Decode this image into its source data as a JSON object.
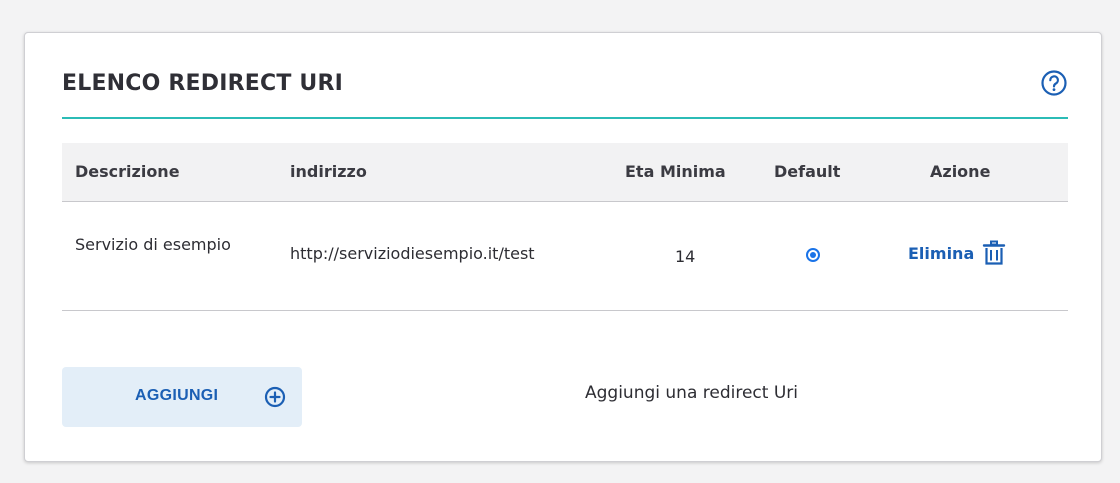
{
  "card": {
    "title": "ELENCO REDIRECT URI",
    "help_icon": "question-circle-icon"
  },
  "table": {
    "headers": {
      "description": "Descrizione",
      "address": "indirizzo",
      "min_age": "Eta Minima",
      "default": "Default",
      "action": "Azione"
    },
    "rows": [
      {
        "description": "Servizio di esempio",
        "address": "http://serviziodiesempio.it/test",
        "min_age": "14",
        "default": true,
        "action_label": "Elimina",
        "action_icon": "trash-icon"
      }
    ]
  },
  "add": {
    "button_label": "AGGIUNGI",
    "button_icon": "plus-circle-icon",
    "hint": "Aggiungi una redirect Uri"
  },
  "colors": {
    "accent_line": "#2bbcb6",
    "link_blue": "#1b5fb4",
    "radio_blue": "#1a73e8",
    "button_bg": "#e3eef8",
    "header_bg": "#f2f2f3"
  }
}
